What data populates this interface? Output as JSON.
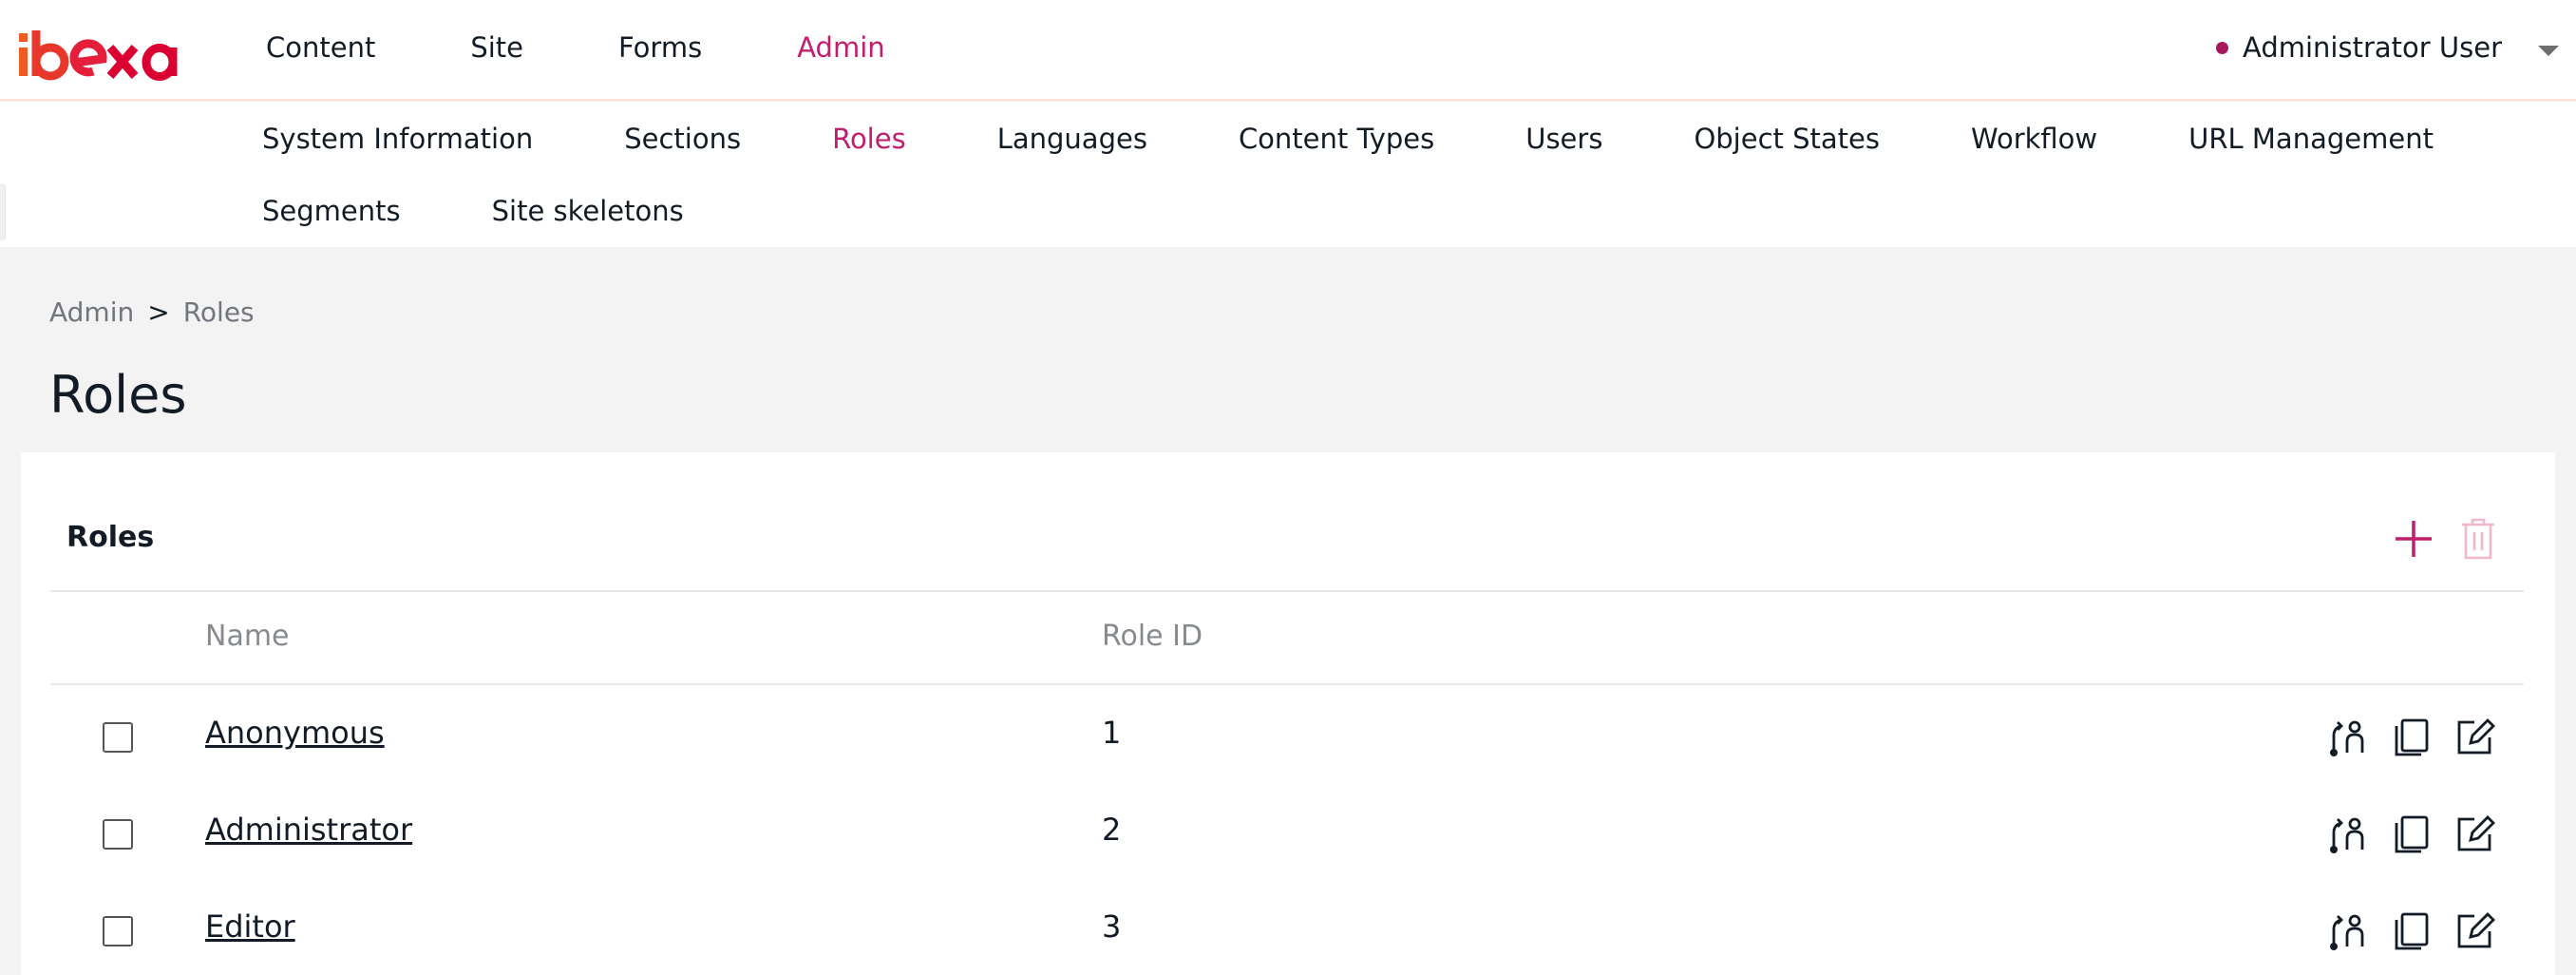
{
  "brand": {
    "logo_text": "ibexa",
    "accent": "#c11e6c",
    "logo_colors": [
      "#f15a22",
      "#db0032"
    ]
  },
  "main_nav": [
    {
      "label": "Content",
      "active": false
    },
    {
      "label": "Site",
      "active": false
    },
    {
      "label": "Forms",
      "active": false
    },
    {
      "label": "Admin",
      "active": true
    }
  ],
  "user": {
    "name": "Administrator User",
    "status_color": "#a8175c"
  },
  "sub_nav": {
    "row1": [
      {
        "label": "System Information",
        "active": false
      },
      {
        "label": "Sections",
        "active": false
      },
      {
        "label": "Roles",
        "active": true
      },
      {
        "label": "Languages",
        "active": false
      },
      {
        "label": "Content Types",
        "active": false
      },
      {
        "label": "Users",
        "active": false
      },
      {
        "label": "Object States",
        "active": false
      },
      {
        "label": "Workflow",
        "active": false
      },
      {
        "label": "URL Management",
        "active": false
      }
    ],
    "row2": [
      {
        "label": "Segments",
        "active": false
      },
      {
        "label": "Site skeletons",
        "active": false
      }
    ]
  },
  "breadcrumb": {
    "items": [
      "Admin",
      "Roles"
    ],
    "separator": ">"
  },
  "page_title": "Roles",
  "panel": {
    "title": "Roles",
    "actions": [
      "add-icon",
      "trash-icon"
    ],
    "columns": [
      "Name",
      "Role ID"
    ],
    "rows": [
      {
        "name": "Anonymous",
        "id": "1"
      },
      {
        "name": "Administrator",
        "id": "2"
      },
      {
        "name": "Editor",
        "id": "3"
      }
    ],
    "row_actions": [
      "assign-user-icon",
      "copy-icon",
      "edit-icon"
    ]
  }
}
